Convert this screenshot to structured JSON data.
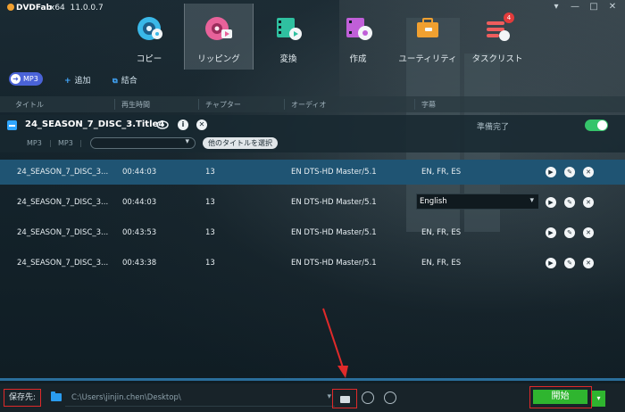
{
  "app": {
    "logo": "DVDFab",
    "arch": "x64",
    "version": "11.0.0.7",
    "window_controls": [
      "▾",
      "—",
      "□",
      "✕"
    ]
  },
  "nav": {
    "items": [
      {
        "label": "コピー",
        "icon": "disc-icon"
      },
      {
        "label": "リッピング",
        "icon": "rip-icon",
        "active": true
      },
      {
        "label": "変換",
        "icon": "film-icon"
      },
      {
        "label": "作成",
        "icon": "create-disc-icon"
      },
      {
        "label": "ユーティリティ",
        "icon": "toolbox-icon"
      },
      {
        "label": "タスクリスト",
        "icon": "task-list-icon",
        "badge": "4"
      }
    ]
  },
  "toolbar": {
    "profile": "MP3",
    "add_label": "追加",
    "merge_label": "結合"
  },
  "columns": {
    "title": "タイトル",
    "duration": "再生時間",
    "chapters": "チャプター",
    "audio": "オーディオ",
    "subtitles": "字幕"
  },
  "disc": {
    "title": "24_SEASON_7_DISC_3.Title4",
    "status": "準備完了",
    "format_primary": "MP3",
    "format_secondary": "MP3",
    "select_other_titles": "他のタイトルを選択"
  },
  "tracks": [
    {
      "name": "24_SEASON_7_DISC_3...",
      "duration": "00:44:03",
      "chapters": "13",
      "audio": "EN  DTS-HD Master/5.1",
      "subtitles": "EN, FR, ES",
      "selected": true
    },
    {
      "name": "24_SEASON_7_DISC_3...",
      "duration": "00:44:03",
      "chapters": "13",
      "audio": "EN  DTS-HD Master/5.1",
      "subtitles": "English",
      "dropdown": true
    },
    {
      "name": "24_SEASON_7_DISC_3...",
      "duration": "00:43:53",
      "chapters": "13",
      "audio": "EN  DTS-HD Master/5.1",
      "subtitles": "EN, FR, ES"
    },
    {
      "name": "24_SEASON_7_DISC_3...",
      "duration": "00:43:38",
      "chapters": "13",
      "audio": "EN  DTS-HD Master/5.1",
      "subtitles": "EN, FR, ES"
    }
  ],
  "bottom": {
    "save_label": "保存先:",
    "output_path": "C:\\Users\\jinjin.chen\\Desktop\\",
    "start_label": "開始"
  },
  "colors": {
    "accent_blue": "#2fa6ff",
    "selected_row": "#1f5473",
    "start_green": "#2fb52f",
    "annotation_red": "#e02a2a",
    "profile_pill": "#4a63d8"
  }
}
